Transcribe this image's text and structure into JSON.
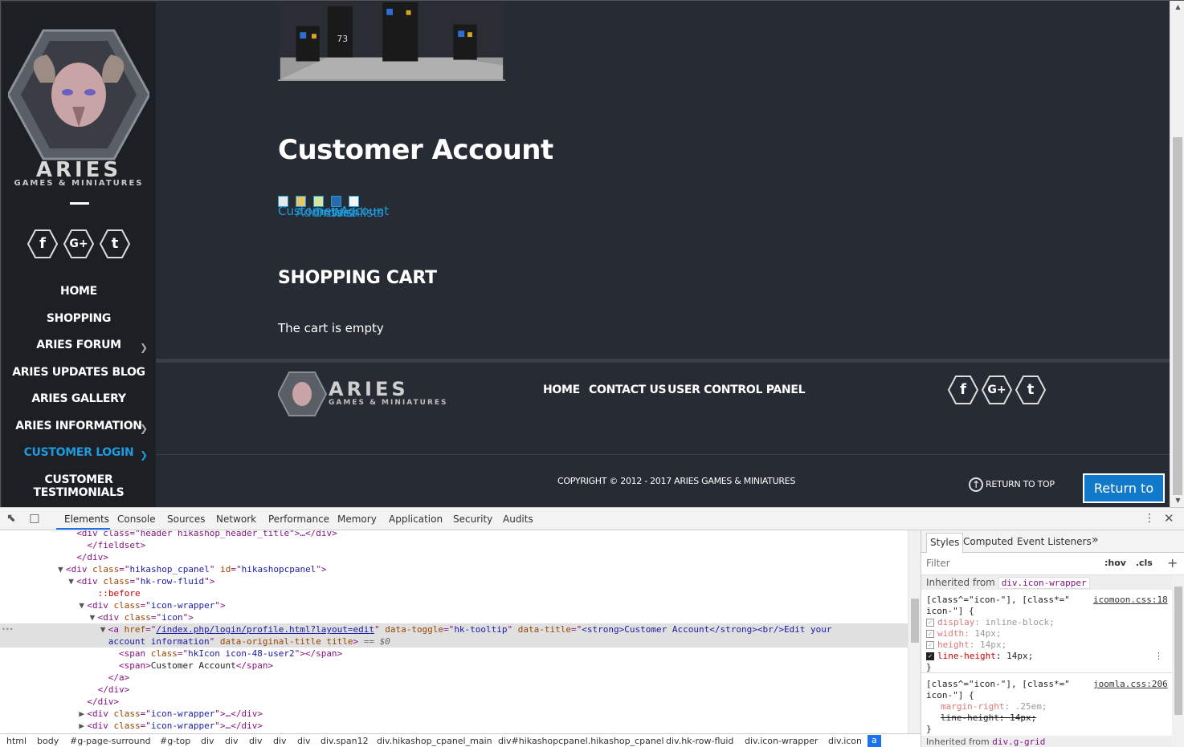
{
  "site": {
    "logo_text": "ARIES",
    "logo_sub": "GAMES & MINIATURES",
    "social": [
      {
        "icon": "facebook-icon",
        "glyph": "f"
      },
      {
        "icon": "google-plus-icon",
        "glyph": "G+"
      },
      {
        "icon": "tumblr-icon",
        "glyph": "t"
      }
    ],
    "nav": [
      {
        "label": "HOME",
        "has_children": false,
        "active": false
      },
      {
        "label": "SHOPPING",
        "has_children": false,
        "active": false
      },
      {
        "label": "ARIES FORUM",
        "has_children": true,
        "active": false
      },
      {
        "label": "ARIES UPDATES BLOG",
        "has_children": false,
        "active": false
      },
      {
        "label": "ARIES GALLERY",
        "has_children": false,
        "active": false
      },
      {
        "label": "ARIES INFORMATION",
        "has_children": true,
        "active": false
      },
      {
        "label": "CUSTOMER LOGIN",
        "has_children": true,
        "active": true
      },
      {
        "label": "CUSTOMER TESTIMONIALS",
        "has_children": false,
        "active": false
      }
    ],
    "accent": "#1e9bde",
    "background": "#272b33",
    "sidebar_bg": "#1c1f24"
  },
  "main": {
    "page_title": "Customer Account",
    "cpanel_links": [
      "Customer Account",
      "Addresses",
      "Orders",
      "Wishlists"
    ],
    "cart_title": "SHOPPING CART",
    "cart_text": "The cart is empty"
  },
  "footer": {
    "nav": [
      "HOME",
      "CONTACT US",
      "USER CONTROL PANEL"
    ],
    "copyright": "COPYRIGHT © 2012 - 2017 ARIES GAMES & MINIATURES",
    "return_top_small": "RETURN TO TOP",
    "return_top_button": "Return to Top"
  },
  "devtools": {
    "tabs": [
      "Elements",
      "Console",
      "Sources",
      "Network",
      "Performance",
      "Memory",
      "Application",
      "Security",
      "Audits"
    ],
    "active_tab": "Elements",
    "dom_lines": [
      {
        "indent": 12,
        "tri": "",
        "html": "<span class='t-tag'>&lt;div class=\"header hikashop_header_title\"&gt;…&lt;/div&gt;</span>"
      },
      {
        "indent": 14,
        "tri": "",
        "html": "<span class='t-tag'>&lt;/fieldset&gt;</span>"
      },
      {
        "indent": 12,
        "tri": "",
        "html": "<span class='t-tag'>&lt;/div&gt;</span>"
      },
      {
        "indent": 10,
        "tri": "▼",
        "html": "<span class='t-tag'>&lt;div </span><span class='t-attr'>class</span><span class='t-tag'>=\"</span><span class='t-val'>hikashop_cpanel</span><span class='t-tag'>\" </span><span class='t-attr'>id</span><span class='t-tag'>=\"</span><span class='t-val'>hikashopcpanel</span><span class='t-tag'>\"&gt;</span>"
      },
      {
        "indent": 12,
        "tri": "▼",
        "html": "<span class='t-tag'>&lt;div </span><span class='t-attr'>class</span><span class='t-tag'>=\"</span><span class='t-val'>hk-row-fluid</span><span class='t-tag'>\"&gt;</span>"
      },
      {
        "indent": 16,
        "tri": "",
        "html": "<span class='t-pseudo'>::before</span>"
      },
      {
        "indent": 14,
        "tri": "▼",
        "html": "<span class='t-tag'>&lt;div </span><span class='t-attr'>class</span><span class='t-tag'>=\"</span><span class='t-val'>icon-wrapper</span><span class='t-tag'>\"&gt;</span>"
      },
      {
        "indent": 16,
        "tri": "▼",
        "html": "<span class='t-tag'>&lt;div </span><span class='t-attr'>class</span><span class='t-tag'>=\"</span><span class='t-val'>icon</span><span class='t-tag'>\"&gt;</span>"
      },
      {
        "indent": 18,
        "tri": "▼",
        "sel": true,
        "html": "<span class='t-tag'>&lt;a </span><span class='t-attr'>href</span><span class='t-tag'>=\"</span><span class='t-link'>/index.php/login/profile.html?layout=edit</span><span class='t-tag'>\" </span><span class='t-attr'>data-toggle</span><span class='t-tag'>=\"</span><span class='t-val'>hk-tooltip</span><span class='t-tag'>\" </span><span class='t-attr'>data-title</span><span class='t-tag'>=\"</span><span class='t-val'>&lt;strong&gt;Customer Account&lt;/strong&gt;&lt;br/&gt;Edit your</span>"
      },
      {
        "indent": 18,
        "tri": "",
        "sel": true,
        "html": "<span class='t-val'>account information</span><span class='t-tag'>\" </span><span class='t-attr'>data-original-title title</span><span class='t-tag'>&gt;</span><span class='t-comment'> == $0</span>"
      },
      {
        "indent": 20,
        "tri": "",
        "html": "<span class='t-tag'>&lt;span </span><span class='t-attr'>class</span><span class='t-tag'>=\"</span><span class='t-val'>hkIcon icon-48-user2</span><span class='t-tag'>\"&gt;&lt;/span&gt;</span>"
      },
      {
        "indent": 20,
        "tri": "",
        "html": "<span class='t-tag'>&lt;span&gt;</span><span class='t-text'>Customer Account</span><span class='t-tag'>&lt;/span&gt;</span>"
      },
      {
        "indent": 18,
        "tri": "",
        "html": "<span class='t-tag'>&lt;/a&gt;</span>"
      },
      {
        "indent": 16,
        "tri": "",
        "html": "<span class='t-tag'>&lt;/div&gt;</span>"
      },
      {
        "indent": 14,
        "tri": "",
        "html": "<span class='t-tag'>&lt;/div&gt;</span>"
      },
      {
        "indent": 14,
        "tri": "▶",
        "html": "<span class='t-tag'>&lt;div </span><span class='t-attr'>class</span><span class='t-tag'>=\"</span><span class='t-val'>icon-wrapper</span><span class='t-tag'>\"&gt;…&lt;/div&gt;</span>"
      },
      {
        "indent": 14,
        "tri": "▶",
        "html": "<span class='t-tag'>&lt;div </span><span class='t-attr'>class</span><span class='t-tag'>=\"</span><span class='t-val'>icon-wrapper</span><span class='t-tag'>\"&gt;…&lt;/div&gt;</span>"
      },
      {
        "indent": 14,
        "tri": "▶",
        "html": "<span class='t-tag'>&lt;div </span><span class='t-attr'>class</span><span class='t-tag'>=\"</span><span class='t-val'>icon-wrapper</span><span class='t-tag'>\"&gt;…&lt;/div&gt;</span>"
      }
    ],
    "breadcrumb": [
      "html",
      "body",
      "#g-page-surround",
      "#g-top",
      "div",
      "div",
      "div",
      "div",
      "div",
      "div.span12",
      "div.hikashop_cpanel_main",
      "div#hikashopcpanel.hikashop_cpanel",
      "div.hk-row-fluid",
      "div.icon-wrapper",
      "div.icon",
      "a"
    ],
    "styles_tabs": [
      "Styles",
      "Computed",
      "Event Listeners"
    ],
    "filter_placeholder": "Filter",
    "filter_hov": ":hov",
    "filter_cls": ".cls",
    "inherited_label": "Inherited from",
    "inherited_selector": "div.icon-wrapper",
    "rule1": {
      "selector_line1": "[class^=\"icon-\"], [class*=\"",
      "selector_line2": "icon-\"] {",
      "source": "icomoon.css:18",
      "props": [
        {
          "name": "display",
          "value": "inline-block;",
          "checked": true,
          "dim": true
        },
        {
          "name": "width",
          "value": "14px;",
          "checked": true,
          "dim": true
        },
        {
          "name": "height",
          "value": "14px;",
          "checked": true,
          "dim": true
        },
        {
          "name": "line-height",
          "value": "14px;",
          "checked": true,
          "dim": false
        }
      ]
    },
    "rule2": {
      "selector_line1": "[class^=\"icon-\"], [class*=\"",
      "selector_line2": "icon-\"] {",
      "source": "joomla.css:206",
      "props": [
        {
          "name": "margin-right",
          "value": ".25em;",
          "dim": true,
          "strike": false
        },
        {
          "name": "line-height",
          "value": "14px;",
          "dim": false,
          "strike": true
        }
      ]
    },
    "inherited_label2": "Inherited from",
    "inherited_selector2": "div.g-grid"
  }
}
